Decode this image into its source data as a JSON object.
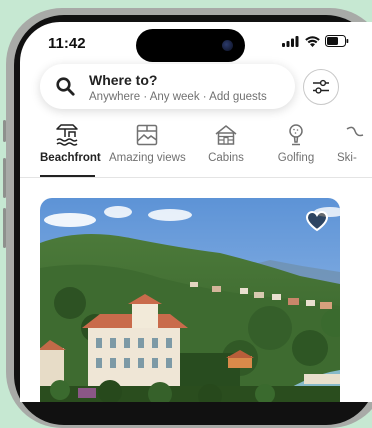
{
  "status_bar": {
    "time": "11:42"
  },
  "search": {
    "title": "Where to?",
    "subtitle": "Anywhere · Any week · Add guests",
    "icon": "search-icon"
  },
  "filter": {
    "icon": "sliders-icon"
  },
  "categories": [
    {
      "label": "Beachfront",
      "icon": "beachfront-icon",
      "active": true
    },
    {
      "label": "Amazing views",
      "icon": "amazing-views-icon",
      "active": false
    },
    {
      "label": "Cabins",
      "icon": "cabin-icon",
      "active": false
    },
    {
      "label": "Golfing",
      "icon": "golfing-icon",
      "active": false
    },
    {
      "label": "Ski-",
      "icon": "skiing-icon",
      "active": false
    }
  ],
  "listing": {
    "favorite_icon": "heart-icon"
  },
  "colors": {
    "background": "#c6e8d2",
    "text_primary": "#222222",
    "text_secondary": "#717171"
  }
}
